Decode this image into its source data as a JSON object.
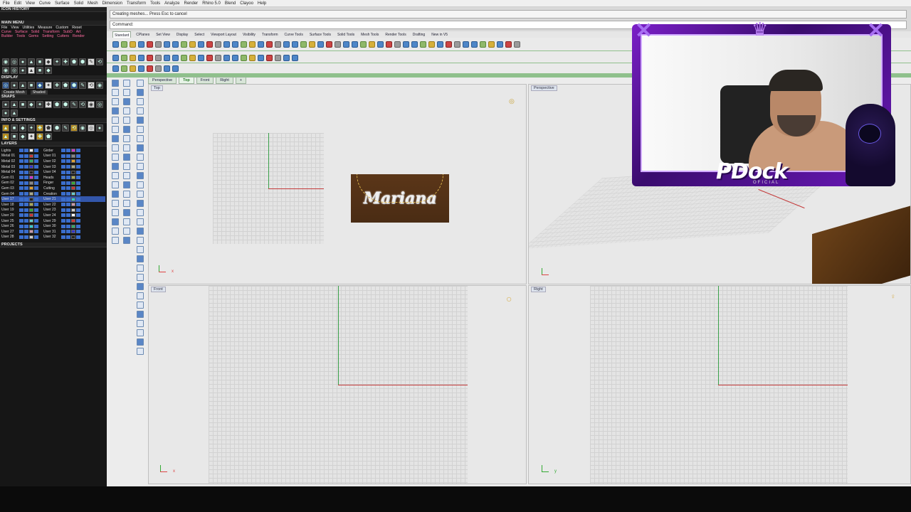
{
  "menubar": {
    "items": [
      "File",
      "Edit",
      "View",
      "Curve",
      "Surface",
      "Solid",
      "Mesh",
      "Dimension",
      "Transform",
      "Tools",
      "Analyze",
      "Render",
      "Rhino 5.0",
      "Blend",
      "Clayoo",
      "Help"
    ]
  },
  "left_panel": {
    "icon_history": "ICON HISTORY",
    "main_menu": "MAIN MENU",
    "menu_row1": [
      "File",
      "View",
      "Utilities",
      "Measure",
      "Custom",
      "Reset"
    ],
    "menu_row2": [
      "Curve",
      "Surface",
      "Solid",
      "Transform",
      "SubD",
      "Art"
    ],
    "menu_row3": [
      "Builder",
      "Tools",
      "Gems",
      "Setting",
      "Cutters",
      "Render"
    ],
    "display": "DISPLAY",
    "create_mesh": "Create Mesh",
    "shaded": "Shaded",
    "snaps": "SNAPS",
    "info_settings": "INFO & SETTINGS",
    "layers": "LAYERS",
    "projects": "PROJECTS",
    "layers_left": [
      "Lights",
      "Metal 01",
      "Metal 02",
      "Metal 03",
      "Metal 04",
      "Gem 01",
      "Gem 02",
      "Gem 03",
      "Gem 04",
      "User 17",
      "User 18",
      "User 19",
      "User 20",
      "User 25",
      "User 26",
      "User 27",
      "User 28"
    ],
    "layers_right": [
      "Girder",
      "User 01",
      "User 02",
      "User 03",
      "User 04",
      "Heads",
      "Finger",
      "Cutting",
      "Creation",
      "User 21",
      "User 22",
      "User 23",
      "User 24",
      "User 29",
      "User 30",
      "User 31",
      "User 32"
    ],
    "layer_colors": [
      "#ffffff",
      "#c33",
      "#3a6",
      "#33c",
      "#222",
      "#c3c",
      "#888",
      "#e0a030",
      "#aa8",
      "#222",
      "#aa5",
      "#3a3",
      "#c33",
      "#6cc",
      "#3cc",
      "#c9a",
      "#ccc"
    ]
  },
  "command": {
    "history": "Creating meshes... Press Esc to cancel",
    "prompt": "Command:"
  },
  "tabs": {
    "items": [
      "Standard",
      "CPlanes",
      "Set View",
      "Display",
      "Select",
      "Viewport Layout",
      "Visibility",
      "Transform",
      "Curve Tools",
      "Surface Tools",
      "Solid Tools",
      "Mesh Tools",
      "Render Tools",
      "Drafting",
      "New in V5"
    ]
  },
  "viewport_tabs": [
    "Perspective",
    "Top",
    "Front",
    "Right",
    "+"
  ],
  "viewports": {
    "top": {
      "label": "Top",
      "nameplate": "Mariana",
      "axis": "x"
    },
    "perspective": {
      "label": "Perspective"
    },
    "front": {
      "label": "Front",
      "axis": "x"
    },
    "right": {
      "label": "Right",
      "axis": "y"
    }
  },
  "overlay": {
    "brand": "PDock",
    "brand_sub": "OFICIAL"
  }
}
